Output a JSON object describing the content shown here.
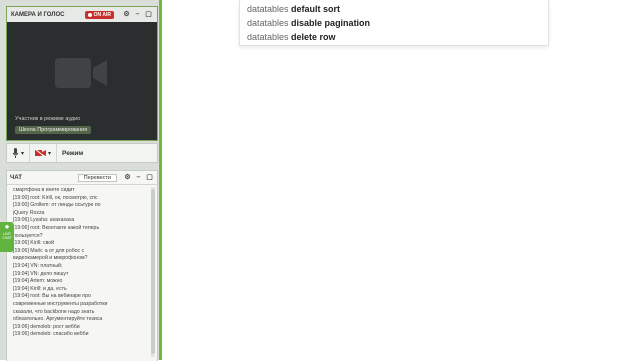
{
  "colors": {
    "accent": "#6dbb45",
    "onair": "#c9302c",
    "camera_bg": "#2b2e2f"
  },
  "camera_panel": {
    "title": "КАМЕРА И ГОЛОС",
    "onair_label": "ON AIR",
    "audio_mode_text": "Участник в режиме аудио",
    "school_label": "Школа Программирования",
    "icon": "video-camera-icon"
  },
  "controls": {
    "mode_label": "Режим",
    "mic_icon": "microphone-icon",
    "cam_icon": "camera-off-icon"
  },
  "chat": {
    "title": "ЧАТ",
    "translate_label": "Перевести",
    "messages": [
      "смартфона в инете сидит",
      "[19:00] root: Kirill, ок, посмотрю, спс",
      "[19:00] Grollem: от линды осьтуре по",
      "jQuery Rozza",
      "[19:06] Lysaha: ахахахаха",
      "[19:06] root: Вконтакте какой теперь",
      "пользуется?",
      "[19:06] Kirill: свой",
      "[19:06] Mark: а от для робос с",
      "видеокамерой и микрофоном?",
      "[19:04] VN: платный;",
      "[19:04] VN: дело пишут",
      "[19:04] Artem: можно",
      "[19:04] Kirill: и да, есть",
      "[19:04] root: Вы на вебинаре про",
      "современные инструменты разработки",
      "сказали, что backbone надо знать",
      "обязательно. Аргументируйте тезиса",
      "[19:06] demoleb: рост вебби",
      "[19:06] demoleb: спасибо вебби"
    ]
  },
  "live_tab": {
    "label": "LIVE CHAT"
  },
  "autocomplete": {
    "items": [
      {
        "prefix": "datatables ",
        "suffix": "default sort"
      },
      {
        "prefix": "datatables ",
        "suffix": "disable pagination"
      },
      {
        "prefix": "datatables ",
        "suffix": "delete row"
      }
    ]
  }
}
